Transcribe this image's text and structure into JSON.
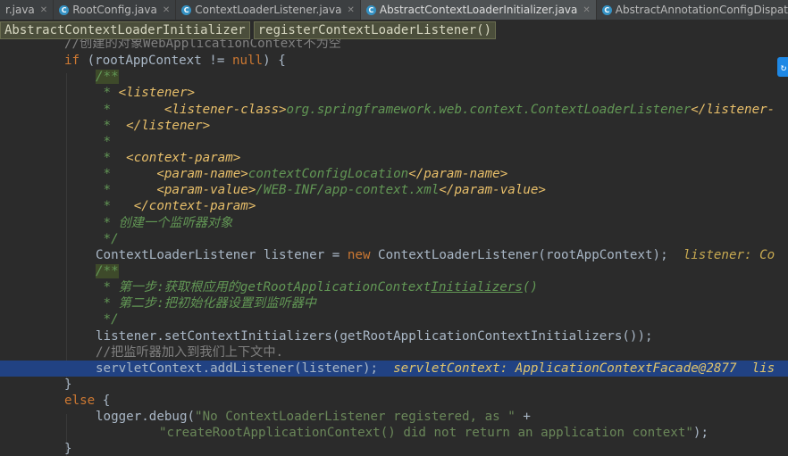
{
  "tabs": [
    {
      "label": "r.java",
      "active": false
    },
    {
      "label": "RootConfig.java",
      "active": false
    },
    {
      "label": "ContextLoaderListener.java",
      "active": false
    },
    {
      "label": "AbstractContextLoaderInitializer.java",
      "active": true
    },
    {
      "label": "AbstractAnnotationConfigDispatcherServletInitializer.java",
      "active": false
    }
  ],
  "breadcrumb": {
    "class_name": "AbstractContextLoaderInitializer",
    "method_name": "registerContextLoaderListener()"
  },
  "code": {
    "l0": "//创建的对象WebApplicationContext不为空",
    "l1_kw": "if",
    "l1_a": " (rootAppContext != ",
    "l1_null": "null",
    "l1_b": ") {",
    "l2": "/**",
    "l3_star": " * ",
    "l3_tag": "<listener>",
    "l4_star": " *       ",
    "l4_tag_open": "<listener-class>",
    "l4_text": "org.springframework.web.context.ContextLoaderListener",
    "l4_tag_close": "</listener-",
    "l5_star": " *  ",
    "l5_tag": "</listener>",
    "l6": " *",
    "l7_star": " *  ",
    "l7_tag": "<context-param>",
    "l8_star": " *      ",
    "l8_tag_open": "<param-name>",
    "l8_text": "contextConfigLocation",
    "l8_tag_close": "</param-name>",
    "l9_star": " *      ",
    "l9_tag_open": "<param-value>",
    "l9_text": "/WEB-INF/app-context.xml",
    "l9_tag_close": "</param-value>",
    "l10_star": " *   ",
    "l10_tag": "</context-param>",
    "l11": " * 创建一个监听器对象",
    "l12": " */",
    "l13_a": "ContextLoaderListener listener = ",
    "l13_new": "new",
    "l13_b": " ContextLoaderListener(rootAppContext);",
    "l13_hint": "  listener: Co",
    "l14": "/**",
    "l15_a": " * 第一步:获取根应用的getRootApplicationContext",
    "l15_u": "Initializers",
    "l15_b": "()",
    "l16": " * 第二步:把初始化器设置到监听器中",
    "l17": " */",
    "l18": "listener.setContextInitializers(getRootApplicationContextInitializers());",
    "l19": "//把监听器加入到我们上下文中.",
    "l20_a": "servletContext.addListener(listener);",
    "l20_hint": "  servletContext: ApplicationContextFacade@2877  lis",
    "l21": "}",
    "l22_kw": "else",
    "l22_b": " {",
    "l23_a": "logger.debug(",
    "l23_s": "\"No ContextLoaderListener registered, as \"",
    "l23_b": " +",
    "l24_s": "\"createRootApplicationContext() did not return an application context\"",
    "l24_b": ");",
    "l25": "}"
  }
}
